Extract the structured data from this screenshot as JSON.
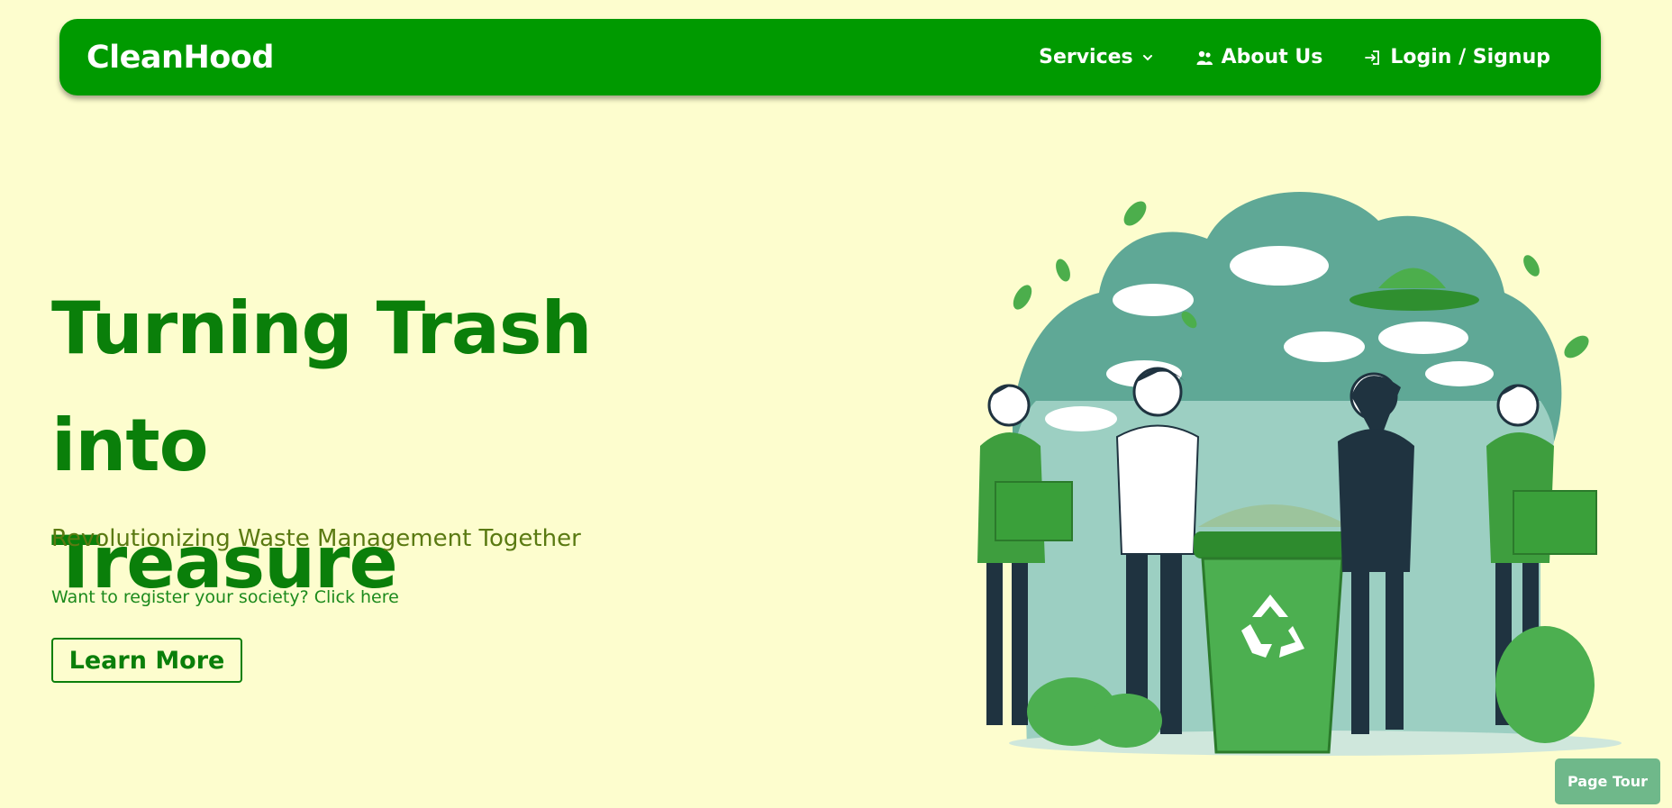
{
  "navbar": {
    "brand": "CleanHood",
    "links": [
      {
        "label": "Services",
        "icon": "chevron-down-icon"
      },
      {
        "label": "About Us",
        "icon": "people-icon"
      },
      {
        "label": "Login / Signup",
        "icon": "login-icon"
      }
    ]
  },
  "hero": {
    "headline_line1": "Turning Trash into",
    "headline_line2": "Treasure",
    "subtitle": "Revolutionizing Waste Management Together",
    "register_text": "Want to register your society? Click here",
    "cta_label": "Learn More"
  },
  "page_tour_label": "Page Tour",
  "colors": {
    "background": "#fdfdce",
    "navbar": "#009a00",
    "heading": "#0a7f0a",
    "page_tour": "#6fb88a"
  }
}
